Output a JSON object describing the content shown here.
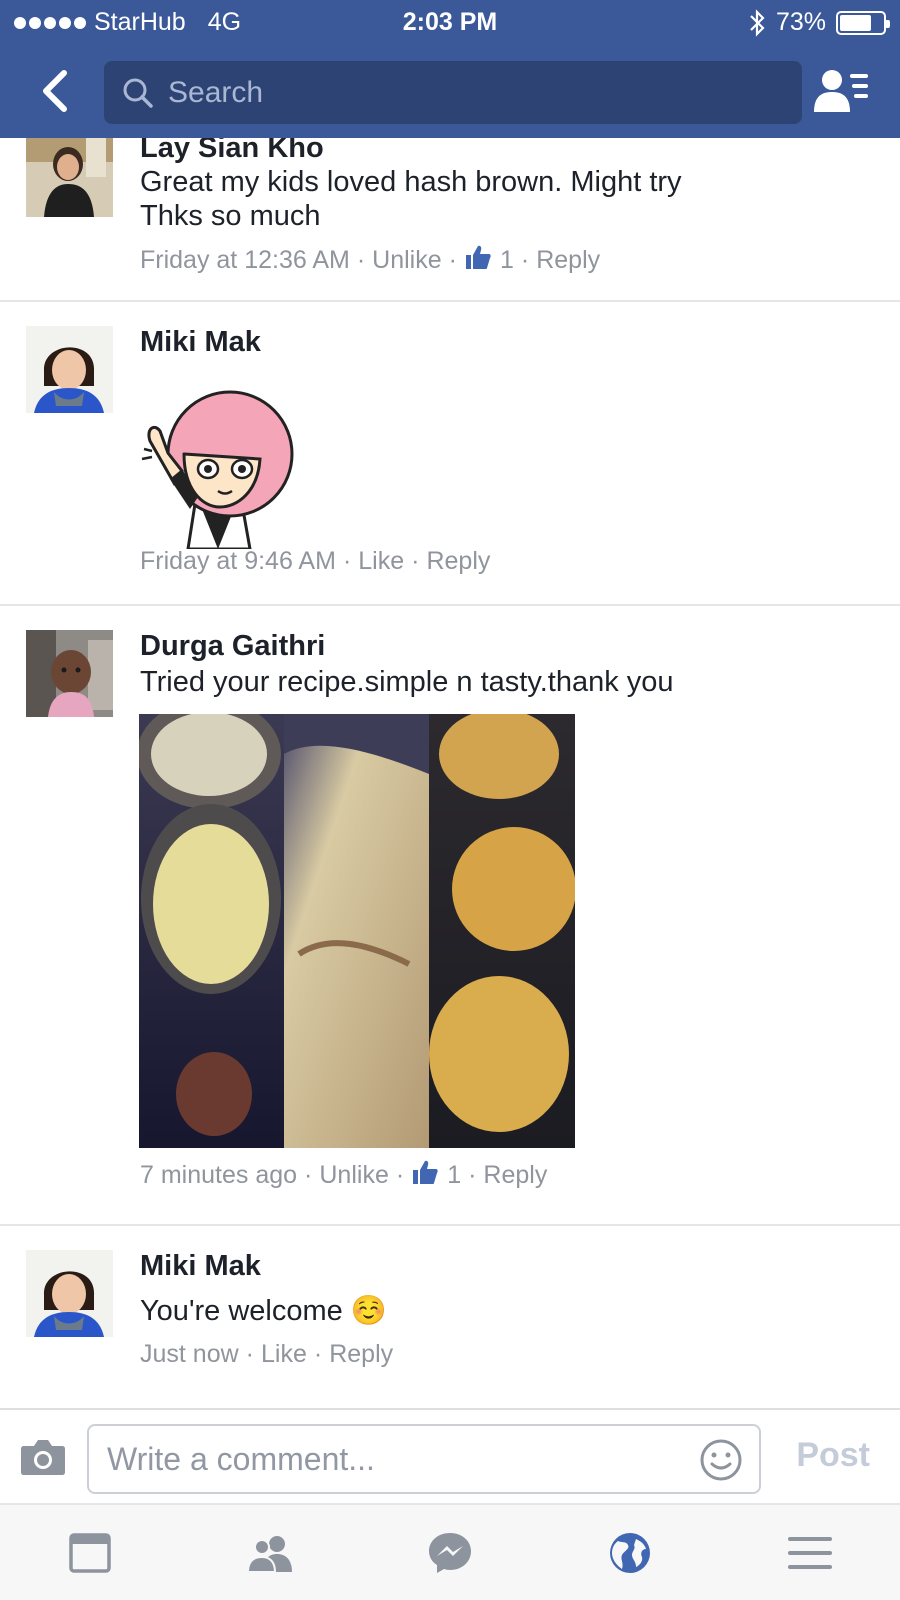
{
  "status_bar": {
    "carrier": "StarHub",
    "network": "4G",
    "time": "2:03 PM",
    "battery": "73%",
    "battery_level": 0.73
  },
  "header": {
    "search_placeholder": "Search"
  },
  "comments": [
    {
      "name": "Lay Sian Kho",
      "text_lines": [
        "Great my kids loved hash brown. Might try",
        "Thks so much"
      ],
      "time": "Friday at 12:36 AM",
      "like_action": "Unlike",
      "like_count": "1",
      "reply_label": "Reply"
    },
    {
      "name": "Miki Mak",
      "time": "Friday at 9:46 AM",
      "like_action": "Like",
      "reply_label": "Reply"
    },
    {
      "name": "Durga Gaithri",
      "text": "Tried your recipe.simple n tasty.thank you",
      "time": "7 minutes ago",
      "like_action": "Unlike",
      "like_count": "1",
      "reply_label": "Reply"
    },
    {
      "name": "Miki Mak",
      "text": "You're welcome ☺️",
      "time": "Just now",
      "like_action": "Like",
      "reply_label": "Reply"
    }
  ],
  "composer": {
    "placeholder": "Write a comment...",
    "post_label": "Post"
  },
  "colors": {
    "brand": "#3b5998",
    "search_bg": "#2d4373",
    "meta": "#90949c",
    "like_blue": "#4267b2",
    "active_tab": "#4267b2"
  }
}
